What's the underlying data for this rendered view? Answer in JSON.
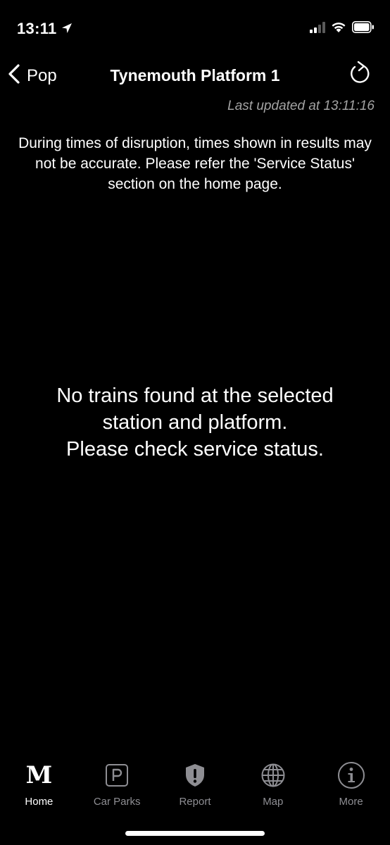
{
  "status_bar": {
    "time": "13:11"
  },
  "nav": {
    "back_label": "Pop",
    "title": "Tynemouth Platform 1"
  },
  "last_updated": "Last updated at 13:11:16",
  "disclaimer": "During times of disruption, times shown in results may not be accurate. Please refer the 'Service Status' section on the home page.",
  "empty_message": {
    "line1": "No trains found at the selected",
    "line2": "station and platform.",
    "line3": "Please check service status."
  },
  "tabs": [
    {
      "label": "Home",
      "icon": "metro-m-logo",
      "active": true
    },
    {
      "label": "Car Parks",
      "icon": "parking-icon",
      "active": false
    },
    {
      "label": "Report",
      "icon": "shield-alert-icon",
      "active": false
    },
    {
      "label": "Map",
      "icon": "globe-icon",
      "active": false
    },
    {
      "label": "More",
      "icon": "info-icon",
      "active": false
    }
  ],
  "colors": {
    "background": "#000000",
    "text": "#ffffff",
    "muted": "#a3a3a3",
    "tab_inactive": "#8e8e93"
  }
}
